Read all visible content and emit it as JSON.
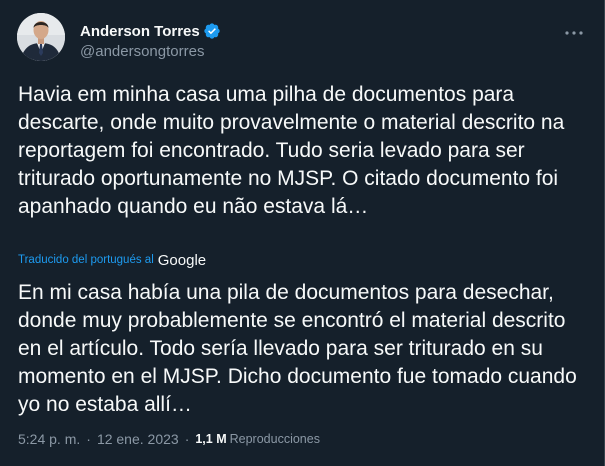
{
  "author": {
    "display_name": "Anderson Torres",
    "handle": "@andersongtorres",
    "verified": true,
    "avatar_icon": "profile-photo-man-in-suit"
  },
  "tweet": {
    "original_text": "Havia em minha casa uma pilha de documentos para descarte, onde muito provavelmente o material descrito na reportagem foi encontrado. Tudo seria levado para ser triturado oportunamente no MJSP. O citado documento foi apanhado quando eu não estava lá…",
    "translated_by_label": "Traducido del portugués al",
    "translator_name": "Google",
    "translated_text": "En mi casa había una pila de documentos para desechar, donde muy probablemente se encontró el material descrito en el artículo. Todo sería llevado para ser triturado en su momento en el MJSP. Dicho documento fue tomado cuando yo no estaba allí…"
  },
  "meta": {
    "time": "5:24 p. m.",
    "separator": "·",
    "date": "12 ene. 2023",
    "views_count": "1,1 M",
    "views_label": "Reproducciones"
  },
  "colors": {
    "background": "#15202b",
    "text": "#f7f9f9",
    "secondary_text": "#8b98a5",
    "accent": "#1d9bf0"
  },
  "icons": {
    "more": "more-horizontal-icon",
    "verified": "verified-badge-icon"
  }
}
